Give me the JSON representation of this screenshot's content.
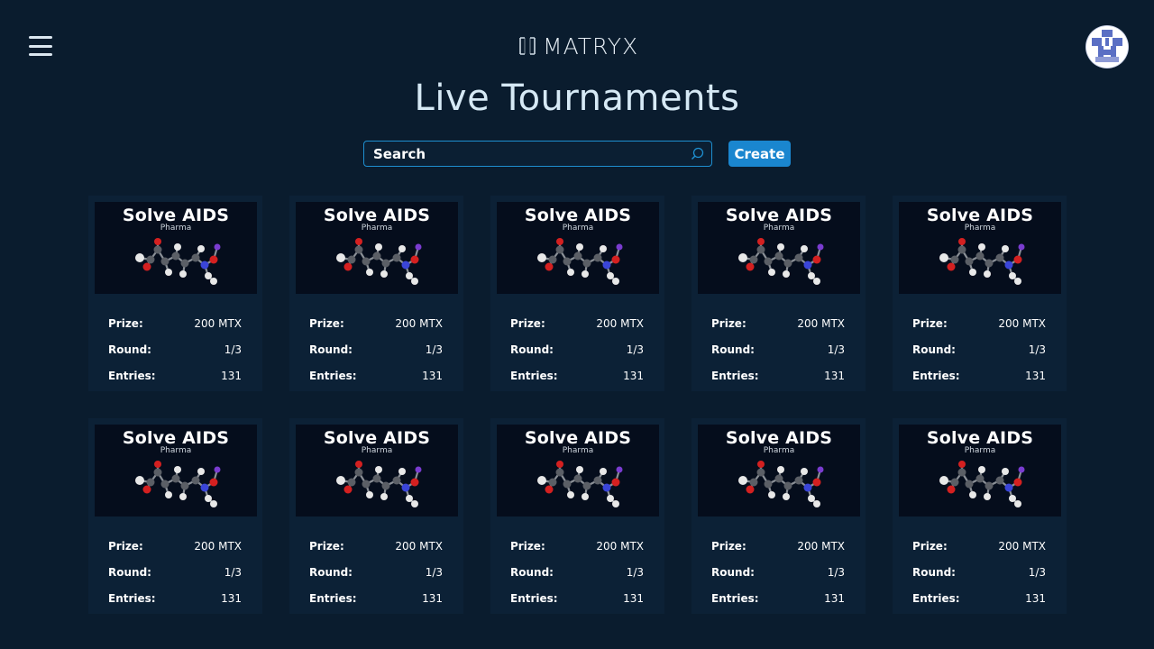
{
  "app": {
    "logo_text": "MATRYX"
  },
  "header": {
    "title": "Live Tournaments",
    "menu_icon": "hamburger-menu-icon",
    "avatar_icon": "user-avatar-icon"
  },
  "search": {
    "placeholder": "Search",
    "icon": "search-icon"
  },
  "toolbar": {
    "create_label": "Create"
  },
  "colors": {
    "background": "#0a1c2e",
    "accent": "#1a86cf",
    "card": "#0c2136"
  },
  "stat_labels": {
    "prize": "Prize:",
    "round": "Round:",
    "entries": "Entries:"
  },
  "tournaments": [
    {
      "title": "Solve AIDS",
      "category": "Pharma",
      "prize": "200 MTX",
      "round": "1/3",
      "entries": "131"
    },
    {
      "title": "Solve AIDS",
      "category": "Pharma",
      "prize": "200 MTX",
      "round": "1/3",
      "entries": "131"
    },
    {
      "title": "Solve AIDS",
      "category": "Pharma",
      "prize": "200 MTX",
      "round": "1/3",
      "entries": "131"
    },
    {
      "title": "Solve AIDS",
      "category": "Pharma",
      "prize": "200 MTX",
      "round": "1/3",
      "entries": "131"
    },
    {
      "title": "Solve AIDS",
      "category": "Pharma",
      "prize": "200 MTX",
      "round": "1/3",
      "entries": "131"
    },
    {
      "title": "Solve AIDS",
      "category": "Pharma",
      "prize": "200 MTX",
      "round": "1/3",
      "entries": "131"
    },
    {
      "title": "Solve AIDS",
      "category": "Pharma",
      "prize": "200 MTX",
      "round": "1/3",
      "entries": "131"
    },
    {
      "title": "Solve AIDS",
      "category": "Pharma",
      "prize": "200 MTX",
      "round": "1/3",
      "entries": "131"
    },
    {
      "title": "Solve AIDS",
      "category": "Pharma",
      "prize": "200 MTX",
      "round": "1/3",
      "entries": "131"
    },
    {
      "title": "Solve AIDS",
      "category": "Pharma",
      "prize": "200 MTX",
      "round": "1/3",
      "entries": "131"
    }
  ]
}
